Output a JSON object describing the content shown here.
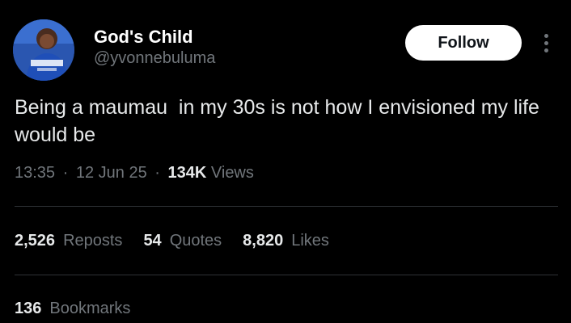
{
  "author": {
    "display_name": "God's Child",
    "handle": "@yvonnebuluma",
    "avatar_icon": "profile-photo"
  },
  "follow_label": "Follow",
  "more_icon": "more-vertical-icon",
  "tweet": {
    "text": "Being a maumau  in my 30s is not how I envisioned my life would be"
  },
  "meta": {
    "time": "13:35",
    "separator": "·",
    "date": "12 Jun 25",
    "views_count": "134K",
    "views_label": "Views"
  },
  "stats": {
    "reposts": {
      "count": "2,526",
      "label": "Reposts"
    },
    "quotes": {
      "count": "54",
      "label": "Quotes"
    },
    "likes": {
      "count": "8,820",
      "label": "Likes"
    },
    "bookmarks": {
      "count": "136",
      "label": "Bookmarks"
    }
  },
  "colors": {
    "background": "#000000",
    "primary_text": "#e7e9ea",
    "secondary_text": "#71767b",
    "divider": "#2f3336",
    "follow_bg": "#ffffff"
  }
}
